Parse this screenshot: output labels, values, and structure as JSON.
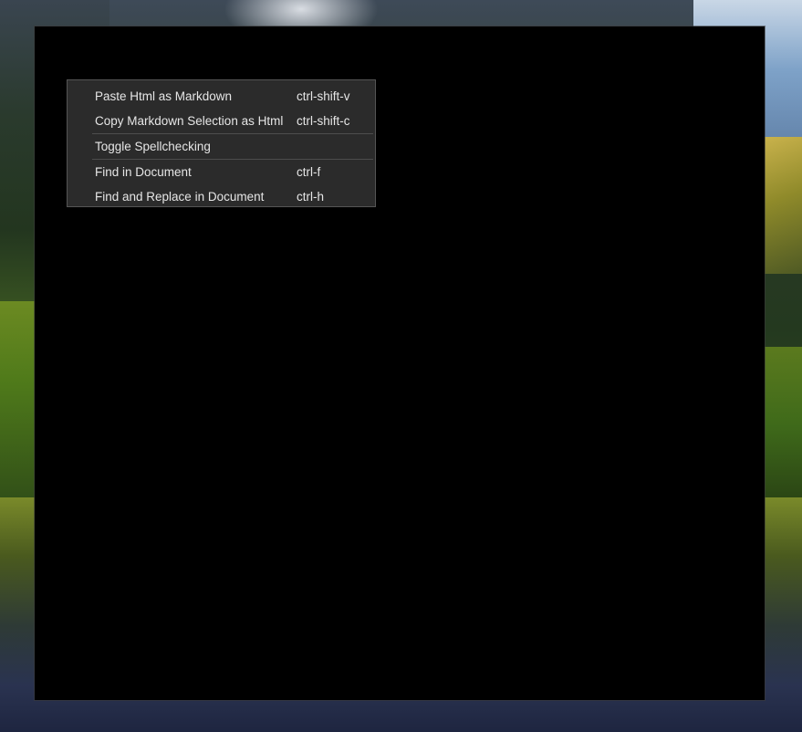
{
  "context_menu": {
    "items": [
      {
        "label": "Paste Html as Markdown",
        "shortcut": "ctrl-shift-v"
      },
      {
        "label": "Copy Markdown Selection as Html",
        "shortcut": "ctrl-shift-c"
      },
      {
        "label": "Toggle Spellchecking",
        "shortcut": ""
      },
      {
        "label": "Find in Document",
        "shortcut": "ctrl-f"
      },
      {
        "label": "Find and Replace in Document",
        "shortcut": "ctrl-h"
      }
    ]
  },
  "colors": {
    "menu_background": "#2b2b2b",
    "menu_border": "#555555",
    "menu_text": "#e6e6e6",
    "window_background": "#000000"
  }
}
